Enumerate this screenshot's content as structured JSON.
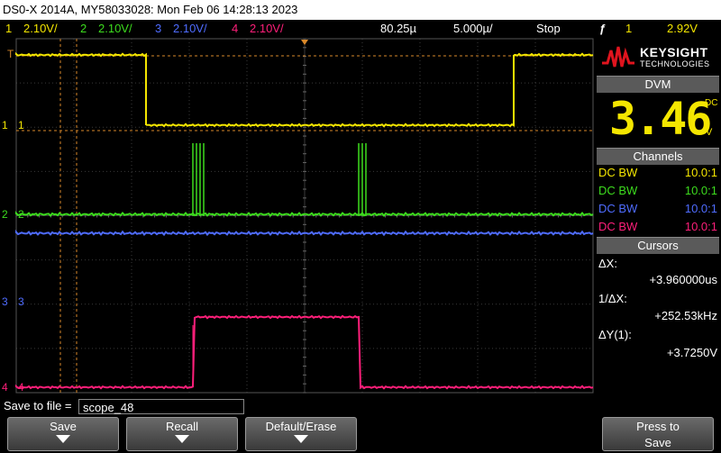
{
  "title": "DS0-X 2014A, MY58033028: Mon Feb 06 14:28:13 2023",
  "status": {
    "ch1_num": "1",
    "ch1_scale": "2.10V/",
    "ch2_num": "2",
    "ch2_scale": "2.10V/",
    "ch3_num": "3",
    "ch3_scale": "2.10V/",
    "ch4_num": "4",
    "ch4_scale": "2.10V/",
    "time_pos": "80.25µ",
    "time_scale": "5.000µ/",
    "run_state": "Stop",
    "trig_icon": "ƒ",
    "trig_ch": "1",
    "trig_level": "2.92V"
  },
  "colors": {
    "ch1": "#f4e600",
    "ch2": "#3ddc1e",
    "ch3": "#4f6cff",
    "ch4": "#ff1f7a",
    "grid": "#3a3a3a",
    "cursor": "#d8882a"
  },
  "markers": {
    "trig": "T",
    "ch1": "1",
    "ch2": "2",
    "ch3": "3",
    "ch4": "4"
  },
  "brand": {
    "name": "KEYSIGHT",
    "sub": "TECHNOLOGIES",
    "logo_icon": "keysight-wave-icon"
  },
  "dvm": {
    "header": "DVM",
    "value": "3.46",
    "mode": "DC",
    "unit": "V"
  },
  "channels": {
    "header": "Channels",
    "rows": [
      {
        "coupling": "DC BW",
        "probe": "10.0:1"
      },
      {
        "coupling": "DC BW",
        "probe": "10.0:1"
      },
      {
        "coupling": "DC BW",
        "probe": "10.0:1"
      },
      {
        "coupling": "DC BW",
        "probe": "10.0:1"
      }
    ]
  },
  "cursors": {
    "header": "Cursors",
    "dx_label": "ΔX:",
    "dx_value": "+3.960000us",
    "inv_label": "1/ΔX:",
    "inv_value": "+252.53kHz",
    "dy_label": "ΔY(1):",
    "dy_value": "+3.7250V"
  },
  "save": {
    "label": "Save to file =",
    "filename": "scope_48"
  },
  "softkeys": {
    "save": "Save",
    "recall": "Recall",
    "default": "Default/Erase",
    "press1": "Press to",
    "press2": "Save"
  }
}
